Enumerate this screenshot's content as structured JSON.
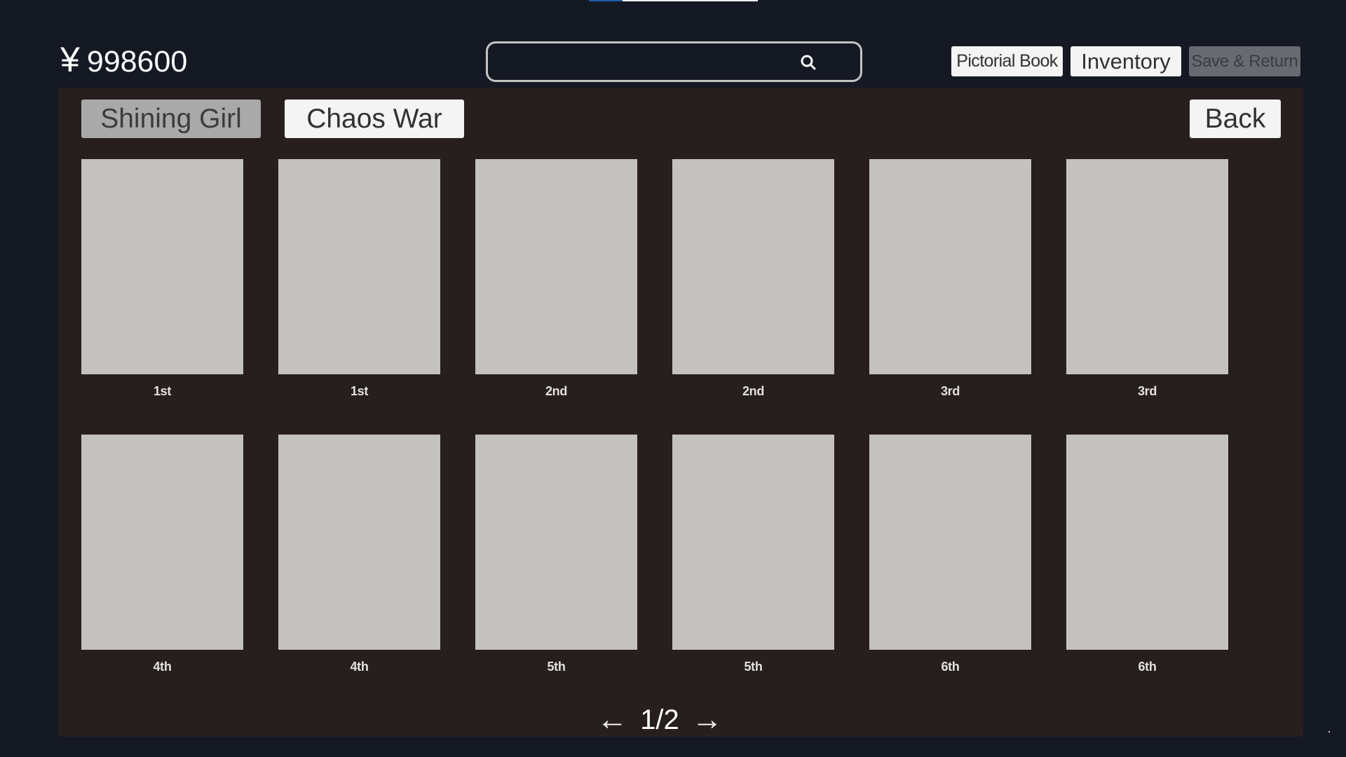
{
  "top_strip": {
    "progress": 0.2,
    "fill_color": "#1f5ea8",
    "track_color": "#f2f2f2"
  },
  "currency": {
    "symbol": "¥",
    "amount": "998600"
  },
  "search": {
    "value": "",
    "placeholder": "",
    "icon": "search-icon"
  },
  "header_buttons": {
    "pictorial_book": "Pictorial Book",
    "inventory": "Inventory",
    "save_return": "Save & Return"
  },
  "tabs": [
    {
      "label": "Shining Girl",
      "active": true
    },
    {
      "label": "Chaos War",
      "active": false
    }
  ],
  "back_label": "Back",
  "cards": [
    {
      "label": "1st"
    },
    {
      "label": "1st"
    },
    {
      "label": "2nd"
    },
    {
      "label": "2nd"
    },
    {
      "label": "3rd"
    },
    {
      "label": "3rd"
    },
    {
      "label": "4th"
    },
    {
      "label": "4th"
    },
    {
      "label": "5th"
    },
    {
      "label": "5th"
    },
    {
      "label": "6th"
    },
    {
      "label": "6th"
    }
  ],
  "pager": {
    "prev": "←",
    "current": "1/2",
    "next": "→"
  },
  "colors": {
    "background": "#151924",
    "panel": "#271f1e",
    "card": "#c3c2be",
    "button": "#f4f4f4",
    "tab_active": "#a9a9a9",
    "button_disabled": "#676a70"
  }
}
